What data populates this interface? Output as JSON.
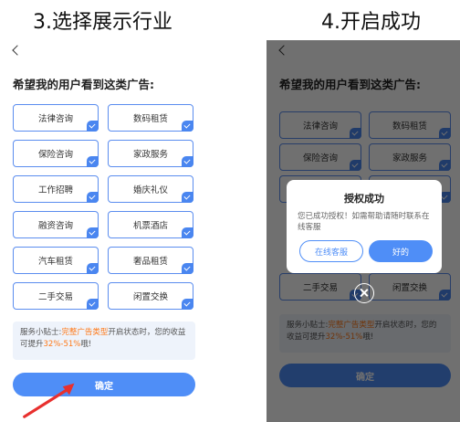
{
  "step3_title": "3.选择展示行业",
  "step4_title": "4.开启成功",
  "screen": {
    "heading": "希望我的用户看到这类广告:",
    "tags": [
      {
        "label": "法律咨询",
        "checked": true
      },
      {
        "label": "数码租赁",
        "checked": true
      },
      {
        "label": "保险咨询",
        "checked": true
      },
      {
        "label": "家政服务",
        "checked": true
      },
      {
        "label": "工作招聘",
        "checked": true
      },
      {
        "label": "婚庆礼仪",
        "checked": true
      },
      {
        "label": "融资咨询",
        "checked": true
      },
      {
        "label": "机票酒店",
        "checked": true
      },
      {
        "label": "汽车租赁",
        "checked": true
      },
      {
        "label": "奢品租赁",
        "checked": true
      },
      {
        "label": "二手交易",
        "checked": true
      },
      {
        "label": "闲置交换",
        "checked": true
      }
    ],
    "tip_prefix": "服务小贴士:",
    "tip_highlight1": "完整广告类型",
    "tip_middle": "开启状态时，您的收益可提升",
    "tip_highlight2": "32%-51%",
    "tip_suffix": "哦!",
    "confirm_label": "确定"
  },
  "dialog": {
    "title": "授权成功",
    "body": "您已成功授权！如需帮助请随时联系在线客服",
    "service_label": "在线客服",
    "ok_label": "好的"
  },
  "colors": {
    "accent": "#4f8ef7",
    "highlight": "#ff7a1a",
    "arrow": "#e8302e"
  }
}
